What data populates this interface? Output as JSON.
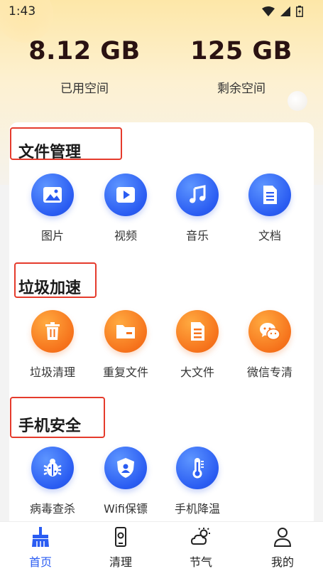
{
  "status_bar": {
    "time": "1:43"
  },
  "storage": {
    "used_value": "8.12 GB",
    "used_label": "已用空间",
    "free_value": "125 GB",
    "free_label": "剩余空间"
  },
  "sections": [
    {
      "title": "文件管理",
      "items": [
        {
          "label": "图片",
          "icon": "image-icon"
        },
        {
          "label": "视频",
          "icon": "video-icon"
        },
        {
          "label": "音乐",
          "icon": "music-icon"
        },
        {
          "label": "文档",
          "icon": "document-icon"
        }
      ]
    },
    {
      "title": "垃圾加速",
      "items": [
        {
          "label": "垃圾清理",
          "icon": "trash-icon"
        },
        {
          "label": "重复文件",
          "icon": "folder-icon"
        },
        {
          "label": "大文件",
          "icon": "large-file-icon"
        },
        {
          "label": "微信专清",
          "icon": "wechat-icon"
        }
      ]
    },
    {
      "title": "手机安全",
      "items": [
        {
          "label": "病毒查杀",
          "icon": "virus-icon"
        },
        {
          "label": "Wifi保镖",
          "icon": "shield-user-icon"
        },
        {
          "label": "手机降温",
          "icon": "thermometer-icon"
        }
      ]
    }
  ],
  "bottom_nav": [
    {
      "label": "首页",
      "icon": "broom-icon",
      "active": true
    },
    {
      "label": "清理",
      "icon": "phone-icon",
      "active": false
    },
    {
      "label": "节气",
      "icon": "weather-icon",
      "active": false
    },
    {
      "label": "我的",
      "icon": "user-icon",
      "active": false
    }
  ],
  "colors": {
    "accent_blue": "#2a5cf2",
    "accent_orange": "#f6731c",
    "highlight_red": "#e53b2c"
  }
}
